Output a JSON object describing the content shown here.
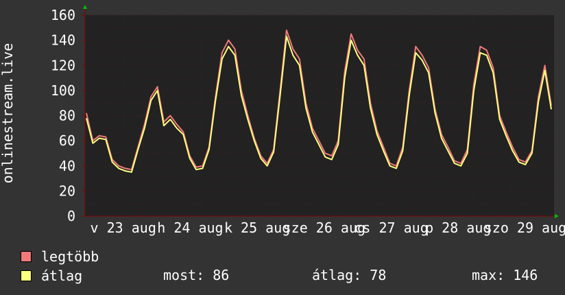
{
  "chart_data": {
    "type": "line",
    "ylabel": "onlinestream.live",
    "ylim": [
      0,
      160
    ],
    "yticks": [
      "0",
      "20",
      "40",
      "60",
      "80",
      "100",
      "120",
      "140",
      "160"
    ],
    "x_tick_labels": [
      "v 23 aug",
      "h 24 aug",
      "k 25 aug",
      "sze 26 aug",
      "cs 27 aug",
      "p 28 aug",
      "szo 29 aug"
    ],
    "grid": true,
    "legend_placement": "bottom-left",
    "colors": {
      "background": "#333333",
      "plot_bg": "#222222",
      "grid": "#3e1e1e",
      "max_line": "#f07a7a",
      "avg_line": "#ffff80",
      "axis_arrow": "#00c000"
    },
    "points_per_day": 12,
    "series": [
      {
        "name": "legtöbb",
        "values": [
          82,
          60,
          64,
          63,
          45,
          40,
          38,
          37,
          55,
          73,
          95,
          103,
          75,
          80,
          73,
          67,
          48,
          39,
          40,
          55,
          95,
          130,
          140,
          133,
          100,
          80,
          62,
          48,
          42,
          53,
          100,
          148,
          133,
          125,
          90,
          70,
          60,
          50,
          48,
          60,
          115,
          145,
          132,
          125,
          90,
          68,
          55,
          42,
          40,
          55,
          100,
          135,
          128,
          118,
          85,
          65,
          55,
          44,
          42,
          53,
          105,
          135,
          132,
          118,
          80,
          67,
          55,
          45,
          43,
          52,
          95,
          120,
          88
        ]
      },
      {
        "name": "átlag",
        "values": [
          78,
          58,
          62,
          61,
          43,
          38,
          36,
          35,
          53,
          70,
          92,
          100,
          72,
          77,
          70,
          65,
          46,
          37,
          38,
          53,
          92,
          125,
          135,
          128,
          96,
          77,
          60,
          46,
          40,
          51,
          96,
          143,
          128,
          120,
          86,
          67,
          57,
          47,
          45,
          57,
          110,
          140,
          128,
          120,
          86,
          65,
          52,
          40,
          38,
          52,
          96,
          130,
          124,
          114,
          82,
          62,
          52,
          42,
          40,
          50,
          100,
          130,
          128,
          114,
          77,
          64,
          52,
          43,
          41,
          50,
          91,
          116,
          85
        ]
      }
    ]
  },
  "legend": {
    "max_label": "legtöbb",
    "avg_label": "átlag"
  },
  "stats": {
    "now": "most: 86",
    "avg": "átlag: 78",
    "max": "max: 146"
  }
}
